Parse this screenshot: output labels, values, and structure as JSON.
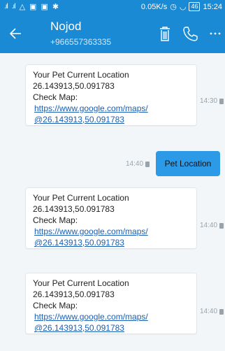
{
  "status_bar": {
    "network_speed": "0.05K/s",
    "battery": "46",
    "time": "15:24"
  },
  "header": {
    "contact_name": "Nojod",
    "contact_number": "+966557363335"
  },
  "messages": [
    {
      "direction": "incoming",
      "line1": "Your Pet Current Location",
      "line2": "26.143913,50.091783",
      "line3": "Check Map:",
      "link1": "https://www.google.com/maps/",
      "link2": "@26.143913,50.091783",
      "time": "14:30"
    },
    {
      "direction": "outgoing",
      "text": "Pet Location",
      "time": "14:40"
    },
    {
      "direction": "incoming",
      "line1": "Your Pet Current Location",
      "line2": "26.143913,50.091783",
      "line3": "Check Map:",
      "link1": "https://www.google.com/maps/",
      "link2": "@26.143913,50.091783",
      "time": "14:40"
    },
    {
      "direction": "incoming",
      "line1": "Your Pet Current Location",
      "line2": "26.143913,50.091783",
      "line3": "Check Map:",
      "link1": "https://www.google.com/maps/",
      "link2": "@26.143913,50.091783",
      "time": "14:40"
    }
  ],
  "colors": {
    "header_bg": "#1a8ad4",
    "outgoing_bubble": "#2c9ae6",
    "link": "#1a5fb4"
  },
  "icons": [
    "signal-icon",
    "warning-icon",
    "gallery-icon",
    "image-icon",
    "wechat-icon",
    "alarm-icon",
    "wifi-icon",
    "battery-icon",
    "back-icon",
    "delete-icon",
    "phone-icon",
    "more-icon",
    "sim-icon"
  ]
}
